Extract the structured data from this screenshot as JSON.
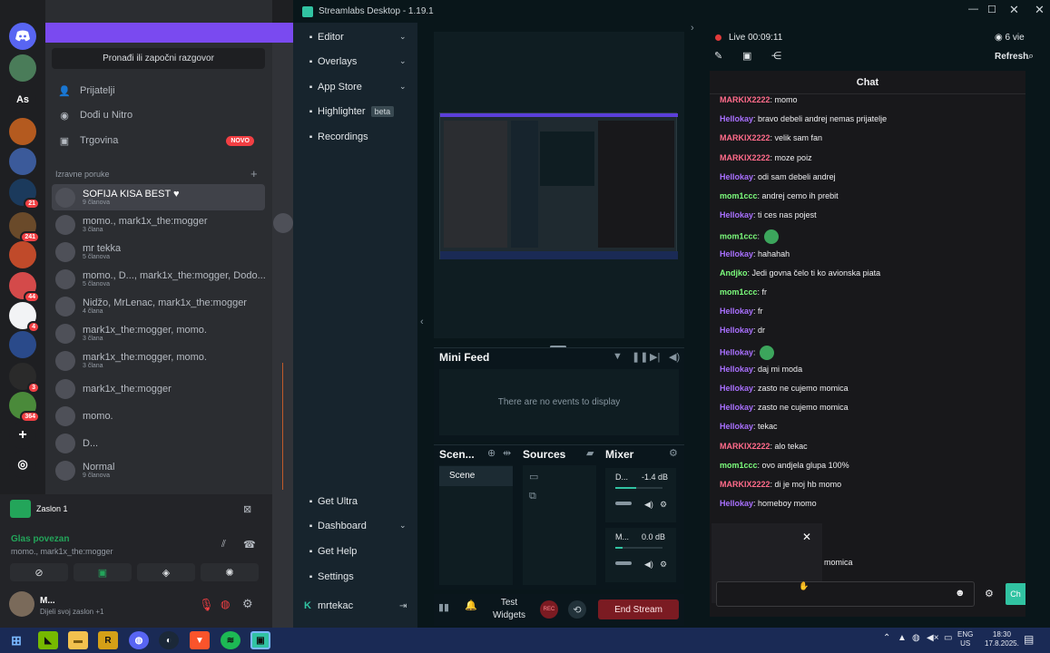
{
  "discord": {
    "rail_badges": [
      "21",
      "241",
      "44",
      "4",
      "3",
      "364"
    ],
    "rail_text": "As",
    "search_button": "Pronađi ili započni razgovor",
    "nav": [
      {
        "label": "Prijatelji",
        "icon": "friends-icon"
      },
      {
        "label": "Dođi u Nitro",
        "icon": "nitro-icon"
      },
      {
        "label": "Trgovina",
        "icon": "shop-icon",
        "badge": "NOVO"
      }
    ],
    "dm_header": "Izravne poruke",
    "dm_add": "+",
    "dms": [
      {
        "name": "SOFIJA KISA BEST ♥",
        "sub": "9 članova",
        "active": true
      },
      {
        "name": "momo., mark1x_the:mogger",
        "sub": "3 člana"
      },
      {
        "name": "mr tekka",
        "sub": "5 članova"
      },
      {
        "name": "momo., D..., mark1x_the:mogger, Dodo...",
        "sub": "5 članova"
      },
      {
        "name": "Nidžo, MrLenac, mark1x_the:mogger",
        "sub": "4 člana"
      },
      {
        "name": "mark1x_the:mogger, momo.",
        "sub": "3 člana"
      },
      {
        "name": "mark1x_the:mogger, momo.",
        "sub": "3 člana"
      },
      {
        "name": "mark1x_the:mogger",
        "sub": ""
      },
      {
        "name": "momo.",
        "sub": ""
      },
      {
        "name": "D...",
        "sub": ""
      },
      {
        "name": "Normal",
        "sub": "9 članova"
      }
    ],
    "screen_share": "Zaslon 1",
    "voice_status": "Glas povezan",
    "voice_channel": "momo., mark1x_the:mogger",
    "user_name": "M...",
    "user_status": "Dijeli svoj zaslon +1"
  },
  "streamlabs": {
    "title": "Streamlabs Desktop - 1.19.1",
    "nav": [
      {
        "label": "Editor",
        "icon": "editor-icon",
        "chevron": true
      },
      {
        "label": "Overlays",
        "icon": "overlays-icon",
        "chevron": true
      },
      {
        "label": "App Store",
        "icon": "appstore-icon",
        "chevron": true
      },
      {
        "label": "Highlighter",
        "icon": "highlighter-icon",
        "tag": "beta"
      },
      {
        "label": "Recordings",
        "icon": "recordings-icon"
      }
    ],
    "bottom_nav": [
      {
        "label": "Get Ultra",
        "icon": "ultra-icon"
      },
      {
        "label": "Dashboard",
        "icon": "dashboard-icon",
        "chevron": true
      },
      {
        "label": "Get Help",
        "icon": "help-icon"
      },
      {
        "label": "Settings",
        "icon": "settings-icon"
      }
    ],
    "user": "mrtekac",
    "mini_feed_title": "Mini Feed",
    "mini_feed_empty": "There are no events to display",
    "scenes_title": "Scen...",
    "scene_item": "Scene",
    "sources_title": "Sources",
    "mixer_title": "Mixer",
    "mixer": [
      {
        "name": "D...",
        "db": "-1.4 dB",
        "level": 0.45
      },
      {
        "name": "M...",
        "db": "0.0 dB",
        "level": 0.15
      }
    ],
    "test_widgets": "Test Widgets",
    "rec": "REC",
    "end_stream": "End Stream",
    "live_time": "Live 00:09:11",
    "viewers": "6 vie",
    "refresh": "Refresh",
    "chat_title": "Chat",
    "chat_button": "Ch",
    "colors": {
      "accent": "#31c3a2",
      "live": "#e23a3a",
      "end": "#7b1b22"
    }
  },
  "chat": [
    {
      "user": "MARKIX2222",
      "text": "momo",
      "color": "#ff6b8a"
    },
    {
      "user": "Hellokay",
      "text": "bravo debeli andrej nemas prijatelje",
      "color": "#a970ff"
    },
    {
      "user": "MARKIX2222",
      "text": "velik sam fan",
      "color": "#ff6b8a"
    },
    {
      "user": "MARKIX2222",
      "text": "moze poiz",
      "color": "#ff6b8a"
    },
    {
      "user": "Hellokay",
      "text": "odi sam debeli andrej",
      "color": "#a970ff"
    },
    {
      "user": "mom1ccc",
      "text": "andrej cemo ih prebit",
      "color": "#7cfc7c"
    },
    {
      "user": "Hellokay",
      "text": "ti ces nas pojest",
      "color": "#a970ff"
    },
    {
      "user": "mom1ccc",
      "text": "",
      "color": "#7cfc7c",
      "emote": true
    },
    {
      "user": "Hellokay",
      "text": "hahahah",
      "color": "#a970ff"
    },
    {
      "user": "Andjko",
      "text": "Jedi govna čelo ti ko avionska piata",
      "color": "#7cfc7c"
    },
    {
      "user": "mom1ccc",
      "text": "fr",
      "color": "#7cfc7c"
    },
    {
      "user": "Hellokay",
      "text": "fr",
      "color": "#a970ff"
    },
    {
      "user": "Hellokay",
      "text": "dr",
      "color": "#a970ff"
    },
    {
      "user": "Hellokay",
      "text": "",
      "color": "#a970ff",
      "emote": true
    },
    {
      "user": "Hellokay",
      "text": "daj mi moda",
      "color": "#a970ff"
    },
    {
      "user": "Hellokay",
      "text": "zasto ne cujemo momica",
      "color": "#a970ff"
    },
    {
      "user": "Hellokay",
      "text": "zasto ne cujemo momica",
      "color": "#a970ff"
    },
    {
      "user": "Hellokay",
      "text": "tekac",
      "color": "#a970ff"
    },
    {
      "user": "MARKIX2222",
      "text": "alo tekac",
      "color": "#ff6b8a"
    },
    {
      "user": "mom1ccc",
      "text": "ovo andjela glupa 100%",
      "color": "#7cfc7c"
    },
    {
      "user": "MARKIX2222",
      "text": "di je moj hb momo",
      "color": "#ff6b8a"
    },
    {
      "user": "Hellokay",
      "text": "homeboy momo",
      "color": "#a970ff"
    }
  ],
  "chat_partial": "momica",
  "taskbar": {
    "lang": "ENG",
    "region": "US",
    "time": "18:30",
    "date": "17.8.2025."
  }
}
